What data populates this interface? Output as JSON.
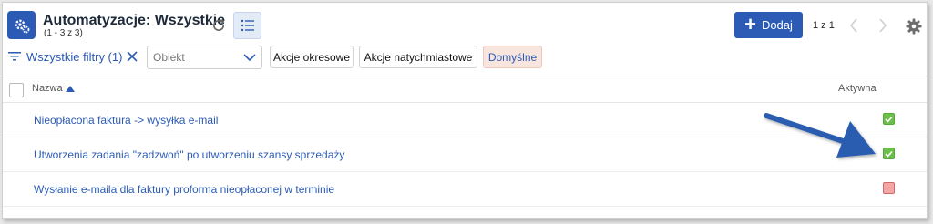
{
  "header": {
    "title": "Automatyzacje: Wszystkie",
    "subtitle": "(1 - 3 z 3)",
    "add_label": "Dodaj",
    "pager_text": "1 z 1",
    "icons": {
      "app": "gear-automation-icon",
      "refresh": "refresh-icon",
      "list_view": "list-view-icon",
      "add": "plus-icon",
      "prev": "chevron-left-icon",
      "next": "chevron-right-icon",
      "settings": "gear-icon"
    }
  },
  "filters": {
    "all_filters_label": "Wszystkie filtry (1)",
    "object_placeholder": "Obiekt",
    "chips": {
      "periodic": "Akcje okresowe",
      "immediate": "Akcje natychmiastowe",
      "default": "Domyślne"
    }
  },
  "table": {
    "columns": {
      "name": "Nazwa",
      "active": "Aktywna"
    },
    "rows": [
      {
        "name": "Nieopłacona faktura -> wysyłka e-mail",
        "active": true
      },
      {
        "name": "Utworzenia zadania \"zadzwoń\" po utworzeniu szansy sprzedaży",
        "active": true
      },
      {
        "name": "Wysłanie e-maila dla faktury proforma nieopłaconej w terminie",
        "active": false
      }
    ]
  },
  "colors": {
    "accent": "#2b5bb5",
    "active_green": "#6cc04a",
    "inactive_red": "#f4a6a6",
    "arrow_blue": "#2a5db0"
  }
}
